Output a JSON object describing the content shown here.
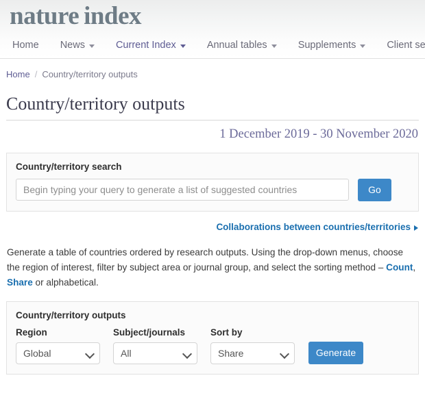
{
  "header": {
    "logo_part1": "nature",
    "logo_part2": "index",
    "nav": [
      {
        "label": "Home",
        "has_caret": false,
        "active": false
      },
      {
        "label": "News",
        "has_caret": true,
        "active": false
      },
      {
        "label": "Current Index",
        "has_caret": true,
        "active": true
      },
      {
        "label": "Annual tables",
        "has_caret": true,
        "active": false
      },
      {
        "label": "Supplements",
        "has_caret": true,
        "active": false
      },
      {
        "label": "Client serv",
        "has_caret": false,
        "active": false
      }
    ]
  },
  "breadcrumb": {
    "home": "Home",
    "separator": "/",
    "current": "Country/territory outputs"
  },
  "page": {
    "title": "Country/territory outputs",
    "date_range": "1 December 2019 - 30 November 2020"
  },
  "search_panel": {
    "title": "Country/territory search",
    "input_value": "",
    "placeholder": "Begin typing your query to generate a list of suggested countries",
    "go_label": "Go"
  },
  "collaborations": {
    "label": "Collaborations between countries/territories"
  },
  "intro": {
    "part1": "Generate a table of countries ordered by research outputs. Using the drop-down menus, choose the region of interest, filter by subject area or journal group, and select the sorting method – ",
    "link_count": "Count",
    "comma": ", ",
    "link_share": "Share",
    "part2": " or alphabetical."
  },
  "outputs_panel": {
    "title": "Country/territory outputs",
    "fields": [
      {
        "label": "Region",
        "value": "Global"
      },
      {
        "label": "Subject/journals",
        "value": "All"
      },
      {
        "label": "Sort by",
        "value": "Share"
      }
    ],
    "generate_label": "Generate"
  },
  "colors": {
    "accent_blue": "#3d88c8",
    "link_blue": "#1a6faf",
    "nav_purple": "#5e5c93",
    "logo_gray": "#6e7c86"
  }
}
